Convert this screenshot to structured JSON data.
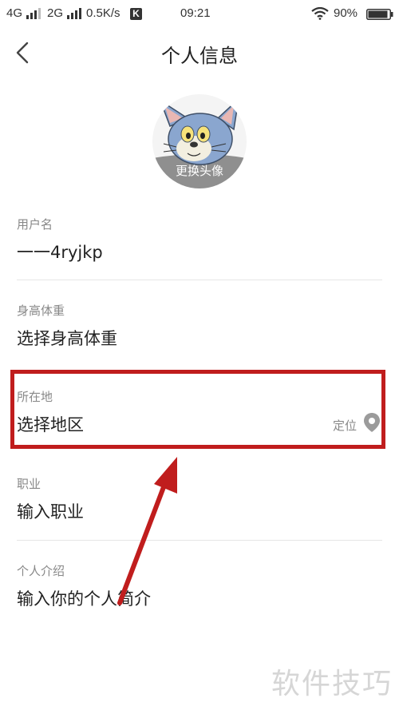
{
  "status_bar": {
    "network_1": "4G",
    "network_2": "2G",
    "speed": "0.5K/s",
    "k_badge": "K",
    "time": "09:21",
    "battery": "90%"
  },
  "header": {
    "title": "个人信息",
    "back_icon": "chevron-left-icon"
  },
  "avatar": {
    "change_label": "更换头像"
  },
  "fields": {
    "username": {
      "label": "用户名",
      "value": "一一4ryjkp"
    },
    "height_weight": {
      "label": "身高体重",
      "value": "选择身高体重"
    },
    "location": {
      "label": "所在地",
      "value": "选择地区",
      "locate_label": "定位",
      "locate_icon": "location-pin-icon"
    },
    "job": {
      "label": "职业",
      "value": "输入职业"
    },
    "intro": {
      "label": "个人介绍",
      "value": "输入你的个人简介"
    }
  },
  "annotation": {
    "highlight_color": "#c01d1d",
    "arrow_color": "#c01d1d"
  },
  "watermark": "软件技巧"
}
